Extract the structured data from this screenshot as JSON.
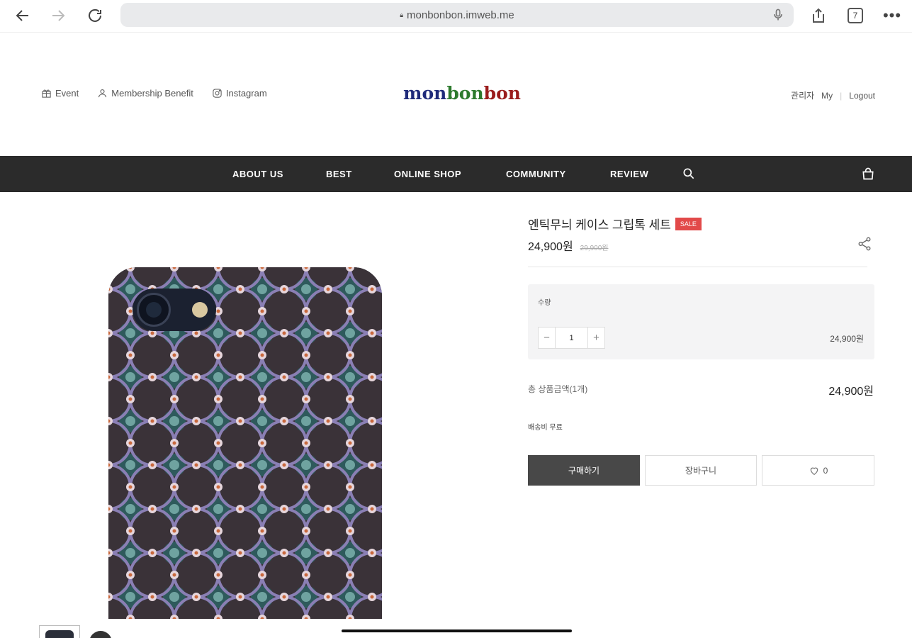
{
  "browser": {
    "url": "monbonbon.imweb.me",
    "tab_count": "7",
    "more": "•••"
  },
  "header": {
    "util_left": [
      {
        "label": "Event",
        "icon": "gift-icon"
      },
      {
        "label": "Membership Benefit",
        "icon": "user-icon"
      },
      {
        "label": "Instagram",
        "icon": "instagram-icon"
      }
    ],
    "logo": {
      "part1": "mon",
      "part2": "bon",
      "part3": "bon"
    },
    "util_right": {
      "admin": "관리자",
      "my": "My",
      "logout": "Logout"
    }
  },
  "nav": {
    "items": [
      "ABOUT US",
      "BEST",
      "ONLINE SHOP",
      "COMMUNITY",
      "REVIEW"
    ]
  },
  "product": {
    "title": "엔틱무늬 케이스 그립톡 세트",
    "badge": "SALE",
    "price": "24,900원",
    "original_price": "29,900원",
    "quantity_label": "수량",
    "quantity": "1",
    "minus": "−",
    "plus": "+",
    "option_price": "24,900원",
    "total_label": "총 상품금액(1개)",
    "total_value": "24,900원",
    "shipping": "배송비 무료",
    "buy_label": "구매하기",
    "cart_label": "장바구니",
    "like_count": "0"
  },
  "colors": {
    "nav_bg": "#2b2b2b",
    "sale_badge": "#e24a4a",
    "buy_button": "#484848",
    "logo_mon": "#1f2a7a",
    "logo_bon1": "#2d7a2d",
    "logo_bon2": "#9a1c1c"
  }
}
